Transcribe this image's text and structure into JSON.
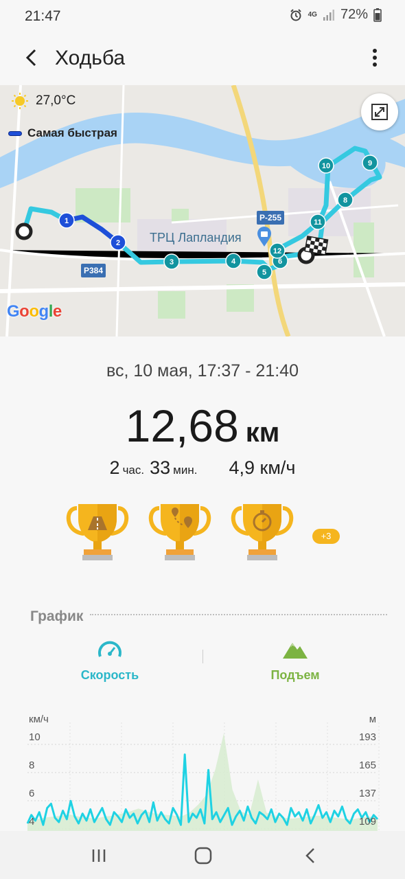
{
  "status": {
    "time": "21:47",
    "network": "4G",
    "battery": "72%",
    "icons": [
      "alarm-icon",
      "network-4g-icon",
      "signal-icon",
      "battery-icon"
    ]
  },
  "app_bar": {
    "title": "Ходьба",
    "back_icon": "back-arrow-icon",
    "menu_icon": "more-vert-icon"
  },
  "map": {
    "weather_temp": "27,0°C",
    "weather_icon": "sun-icon",
    "legend_fastest": "Самая быстрая",
    "expand_icon": "fullscreen-icon",
    "poi_label": "ТРЦ Лапландия",
    "road_p255": "Р-255",
    "road_p384": "Р384",
    "provider_logo": "Google",
    "markers": [
      "1",
      "2",
      "3",
      "4",
      "5",
      "6",
      "12",
      "11",
      "8",
      "9",
      "10"
    ],
    "colors": {
      "route": "#35c9e0",
      "marker_fast": "#1e4fd8",
      "marker": "#12949f",
      "water": "#a9d3f5",
      "green": "#cde9c4"
    }
  },
  "summary": {
    "date_range": "вс, 10 мая, 17:37 - 21:40",
    "distance_value": "12,68",
    "distance_unit": "км",
    "hours": "2",
    "hours_unit": "час.",
    "minutes": "33",
    "minutes_unit": "мин.",
    "speed": "4,9 км/ч"
  },
  "achievements": {
    "trophies": [
      "road-trophy-icon",
      "route-trophy-icon",
      "stopwatch-trophy-icon"
    ],
    "more_badge": "+3",
    "color": "#f5b51e"
  },
  "graph": {
    "title": "График",
    "tabs": [
      {
        "label": "Скорость",
        "icon": "speedometer-icon",
        "color": "#2bb7c9"
      },
      {
        "label": "Подъем",
        "icon": "mountain-icon",
        "color": "#7cb342"
      }
    ]
  },
  "chart_data": {
    "type": "line",
    "left_axis_label": "км/ч",
    "right_axis_label": "м",
    "left_ticks": [
      10,
      8,
      6,
      4
    ],
    "right_ticks": [
      193,
      165,
      137,
      109
    ],
    "ylim_left": [
      3.4,
      10
    ],
    "series": [
      {
        "name": "Скорость",
        "axis": "left",
        "values": [
          3.8,
          4.4,
          4.0,
          4.6,
          3.7,
          4.9,
          5.2,
          4.2,
          3.9,
          4.7,
          4.1,
          5.4,
          4.3,
          3.8,
          4.5,
          4.0,
          4.8,
          3.9,
          4.4,
          4.9,
          4.1,
          3.7,
          4.6,
          4.3,
          3.9,
          4.8,
          4.2,
          4.5,
          3.8,
          4.4,
          4.7,
          3.9,
          5.3,
          4.0,
          4.6,
          4.1,
          3.8,
          4.9,
          4.4,
          3.7,
          8.7,
          3.9,
          4.5,
          4.2,
          4.8,
          3.8,
          7.6,
          4.1,
          4.6,
          3.9,
          4.4,
          4.9,
          3.7,
          4.3,
          4.7,
          4.0,
          5.0,
          4.2,
          3.8,
          4.6,
          4.4,
          4.1,
          4.8,
          3.9,
          4.5,
          4.2,
          3.7,
          4.9,
          4.3,
          4.6,
          4.0,
          4.8,
          3.8,
          4.4,
          5.1,
          4.2,
          4.6,
          3.9,
          4.7,
          4.3,
          5.0,
          4.1,
          3.8,
          4.5,
          4.8,
          4.2,
          4.6,
          3.9,
          4.4,
          4.1
        ]
      },
      {
        "name": "Подъем",
        "axis": "right",
        "values": [
          108,
          110,
          112,
          113,
          114,
          115,
          113,
          112,
          111,
          113,
          114,
          116,
          118,
          121,
          118,
          116,
          115,
          114,
          113,
          117,
          125,
          135,
          160,
          196,
          140,
          118,
          115,
          150,
          117,
          113,
          112,
          111,
          112,
          113,
          114,
          113,
          112,
          111,
          110,
          112,
          113,
          112
        ]
      }
    ]
  },
  "nav_bar": {
    "icons": [
      "recent-apps-icon",
      "home-icon",
      "back-icon"
    ]
  }
}
